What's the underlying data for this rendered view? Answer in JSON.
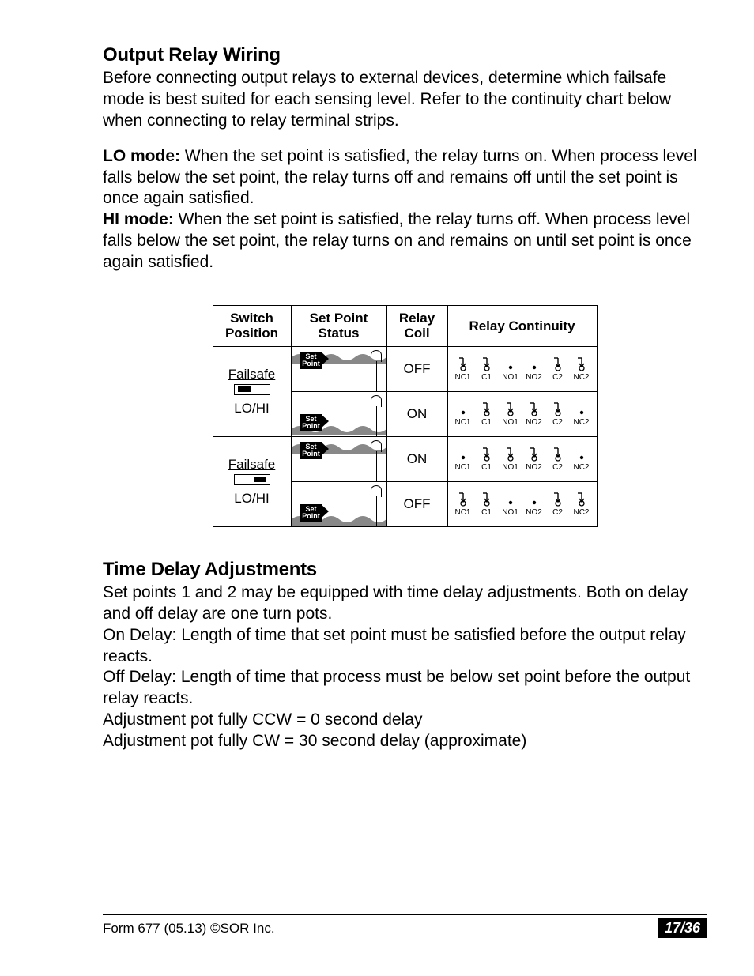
{
  "sections": {
    "relay": {
      "heading": "Output Relay Wiring",
      "intro": "Before connecting output relays to external devices, determine which failsafe mode is best suited for each sensing level. Refer to the continuity chart below when connecting to relay terminal strips.",
      "lo_label": "LO mode:",
      "lo_text": " When the set point is satisfied, the relay turns on. When process level falls below the set point, the relay turns off and remains off until the set point is once again satisfied.",
      "hi_label": "HI mode:",
      "hi_text": " When the set point is satisfied, the relay turns off. When process level falls below the set point, the relay turns on and remains on until set point is once again satisfied."
    },
    "time": {
      "heading": "Time Delay Adjustments",
      "p1": "Set points 1 and 2 may be equipped with time delay adjustments. Both on delay and off delay are one turn pots.",
      "p2": "On Delay: Length of time that set point must be satisfied before the output relay reacts.",
      "p3": "Off Delay: Length of time that process must be below set point before the output relay reacts.",
      "p4": "Adjustment pot fully CCW = 0 second delay",
      "p5": "Adjustment pot fully CW = 30 second delay (approximate)"
    }
  },
  "table": {
    "headers": {
      "switch": "Switch Position",
      "setpoint": "Set Point Status",
      "coil": "Relay Coil",
      "continuity": "Relay Continuity"
    },
    "switch_labels": {
      "failsafe": "Failsafe",
      "lohi": "LO/HI"
    },
    "setpoint_flag": "Set Point",
    "terminals": [
      "NC1",
      "C1",
      "NO1",
      "NO2",
      "C2",
      "NC2"
    ],
    "rows": [
      {
        "switch_side": "left",
        "sp_level": "high",
        "coil": "OFF",
        "states": [
          "closed",
          "closed",
          "open",
          "open",
          "closed",
          "closed"
        ]
      },
      {
        "switch_side": "left",
        "sp_level": "low",
        "coil": "ON",
        "states": [
          "open",
          "closed",
          "closed",
          "closed",
          "closed",
          "open"
        ]
      },
      {
        "switch_side": "right",
        "sp_level": "high",
        "coil": "ON",
        "states": [
          "open",
          "closed",
          "closed",
          "closed",
          "closed",
          "open"
        ]
      },
      {
        "switch_side": "right",
        "sp_level": "low",
        "coil": "OFF",
        "states": [
          "closed",
          "closed",
          "open",
          "open",
          "closed",
          "closed"
        ]
      }
    ]
  },
  "footer": {
    "left": "Form 677 (05.13) ©SOR Inc.",
    "page": "17/36"
  }
}
